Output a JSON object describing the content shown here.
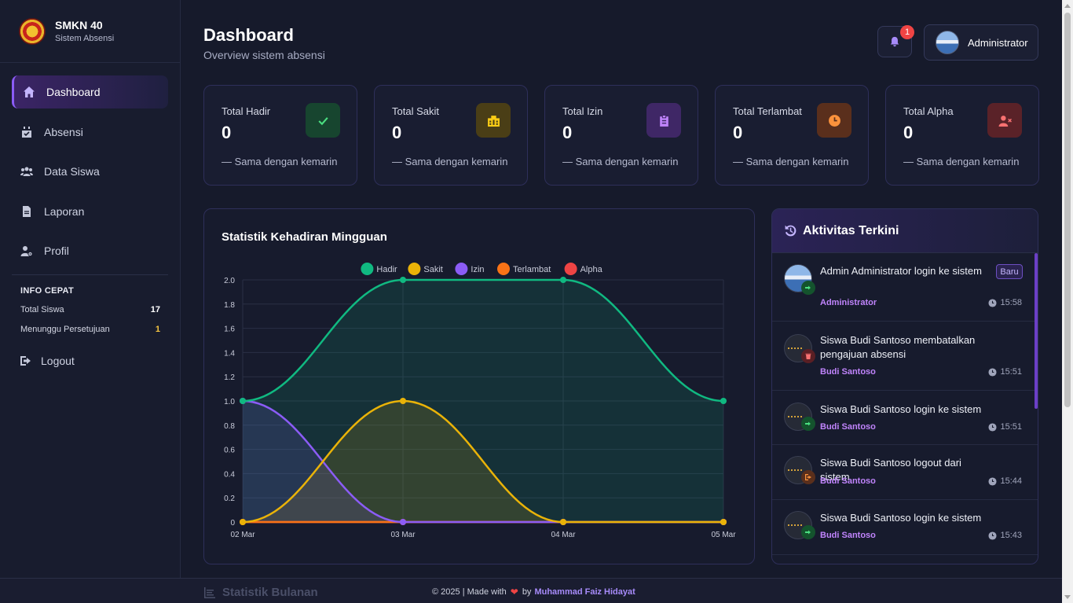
{
  "brand": {
    "name": "SMKN 40",
    "subtitle": "Sistem Absensi"
  },
  "sidebar": {
    "items": [
      {
        "label": "Dashboard",
        "icon": "home-icon",
        "active": true
      },
      {
        "label": "Absensi",
        "icon": "calendar-check-icon"
      },
      {
        "label": "Data Siswa",
        "icon": "users-icon"
      },
      {
        "label": "Laporan",
        "icon": "file-icon"
      },
      {
        "label": "Profil",
        "icon": "user-gear-icon"
      }
    ],
    "quick_info": {
      "title": "INFO CEPAT",
      "rows": [
        {
          "label": "Total Siswa",
          "value": "17"
        },
        {
          "label": "Menunggu Persetujuan",
          "value": "1"
        }
      ]
    },
    "logout_label": "Logout"
  },
  "header": {
    "title": "Dashboard",
    "subtitle": "Overview sistem absensi",
    "notification_count": "1",
    "user_name": "Administrator"
  },
  "stats": [
    {
      "label": "Total Hadir",
      "value": "0",
      "trend": "Sama dengan kemarin",
      "icon": "check-icon",
      "color": "#22c55e"
    },
    {
      "label": "Total Sakit",
      "value": "0",
      "trend": "Sama dengan kemarin",
      "icon": "hospital-icon",
      "color": "#eab308"
    },
    {
      "label": "Total Izin",
      "value": "0",
      "trend": "Sama dengan kemarin",
      "icon": "clipboard-icon",
      "color": "#a855f7"
    },
    {
      "label": "Total Terlambat",
      "value": "0",
      "trend": "Sama dengan kemarin",
      "icon": "clock-icon",
      "color": "#f97316"
    },
    {
      "label": "Total Alpha",
      "value": "0",
      "trend": "Sama dengan kemarin",
      "icon": "user-x-icon",
      "color": "#ef4444"
    }
  ],
  "chart_panel": {
    "title": "Statistik Kehadiran Mingguan"
  },
  "chart_data": {
    "type": "line",
    "categories": [
      "02 Mar",
      "03 Mar",
      "04 Mar",
      "05 Mar"
    ],
    "ylim": [
      0,
      2.0
    ],
    "yticks": [
      "0",
      "0.2",
      "0.4",
      "0.6",
      "0.8",
      "1.0",
      "1.2",
      "1.4",
      "1.6",
      "1.8",
      "2.0"
    ],
    "legend_position": "top",
    "grid": true,
    "series": [
      {
        "name": "Hadir",
        "color": "#10b981",
        "values": [
          1,
          2,
          2,
          1
        ]
      },
      {
        "name": "Sakit",
        "color": "#eab308",
        "values": [
          0,
          1,
          0,
          0
        ]
      },
      {
        "name": "Izin",
        "color": "#8b5cf6",
        "values": [
          1,
          0,
          0,
          0
        ]
      },
      {
        "name": "Terlambat",
        "color": "#f97316",
        "values": [
          0,
          0,
          0,
          0
        ]
      },
      {
        "name": "Alpha",
        "color": "#ef4444",
        "values": [
          0,
          0,
          0,
          0
        ]
      }
    ]
  },
  "activity": {
    "title": "Aktivitas Terkini",
    "new_label": "Baru",
    "items": [
      {
        "text": "Admin Administrator login ke sistem",
        "user": "Administrator",
        "time": "15:58",
        "icon": "login-icon",
        "color": "#22c55e"
      },
      {
        "text": "Siswa Budi Santoso membatalkan pengajuan absensi",
        "user": "Budi Santoso",
        "time": "15:51",
        "icon": "trash-icon",
        "color": "#ef4444"
      },
      {
        "text": "Siswa Budi Santoso login ke sistem",
        "user": "Budi Santoso",
        "time": "15:51",
        "icon": "login-icon",
        "color": "#22c55e"
      },
      {
        "text": "Siswa Budi Santoso logout dari sistem",
        "user": "Budi Santoso",
        "time": "15:44",
        "icon": "logout-icon",
        "color": "#f97316"
      },
      {
        "text": "Siswa Budi Santoso login ke sistem",
        "user": "Budi Santoso",
        "time": "15:43",
        "icon": "login-icon",
        "color": "#22c55e"
      }
    ]
  },
  "footer": {
    "ghost_heading": "Statistik Bulanan",
    "copyright": "© 2025 | Made with",
    "by": "by",
    "author": "Muhammad Faiz Hidayat"
  }
}
